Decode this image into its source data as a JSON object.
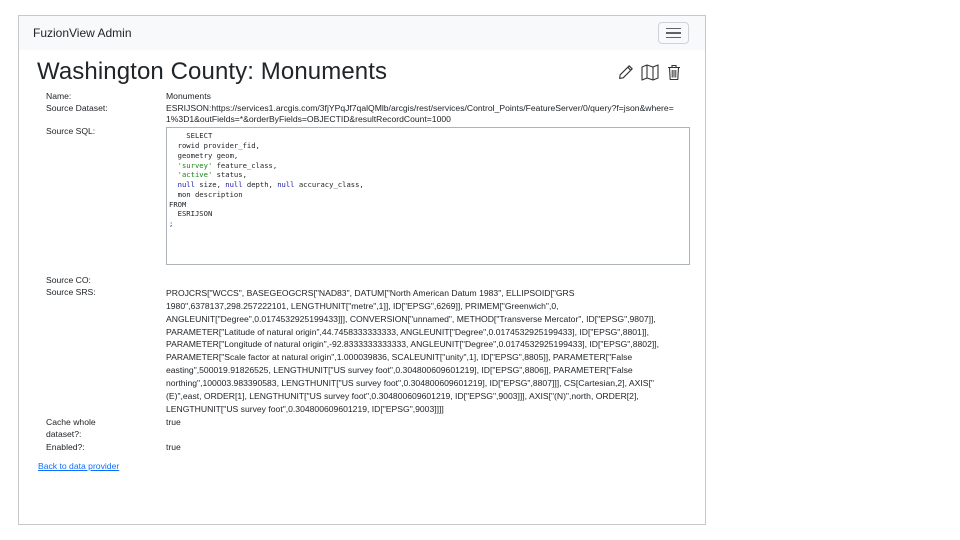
{
  "navbar": {
    "brand": "FuzionView Admin"
  },
  "page": {
    "title": "Washington County: Monuments"
  },
  "fields": {
    "name_label": "Name:",
    "name_value": "Monuments",
    "dataset_label": "Source Dataset:",
    "dataset_value": "ESRIJSON:https://services1.arcgis.com/3fjYPqJf7qalQMlb/arcgis/rest/services/Control_Points/FeatureServer/0/query?f=json&where=1%3D1&outFields=*&orderByFields=OBJECTID&resultRecordCount=1000",
    "sql_label": "Source SQL:",
    "sql": {
      "l1": "    SELECT",
      "l2": "  rowid provider_fid,",
      "l3": "  geometry geom,",
      "l4_str": "'survey'",
      "l4_rest": " feature_class,",
      "l5_str": "'active'",
      "l5_rest": " status,",
      "l6_kw1": "null",
      "l6_a": " size, ",
      "l6_kw2": "null",
      "l6_b": " depth, ",
      "l6_kw3": "null",
      "l6_c": " accuracy_class,",
      "l7": "  mon description",
      "l8": "FROM",
      "l9": "  ESRIJSON",
      "l10": ";"
    },
    "co_label": "Source CO:",
    "co_value": "",
    "srs_label": "Source SRS:",
    "srs_value": "PROJCRS[\"WCCS\", BASEGEOGCRS[\"NAD83\", DATUM[\"North American Datum 1983\", ELLIPSOID[\"GRS 1980\",6378137,298.257222101, LENGTHUNIT[\"metre\",1]], ID[\"EPSG\",6269]], PRIMEM[\"Greenwich\",0, ANGLEUNIT[\"Degree\",0.0174532925199433]]], CONVERSION[\"unnamed\", METHOD[\"Transverse Mercator\", ID[\"EPSG\",9807]], PARAMETER[\"Latitude of natural origin\",44.7458333333333, ANGLEUNIT[\"Degree\",0.0174532925199433], ID[\"EPSG\",8801]], PARAMETER[\"Longitude of natural origin\",-92.8333333333333, ANGLEUNIT[\"Degree\",0.0174532925199433], ID[\"EPSG\",8802]], PARAMETER[\"Scale factor at natural origin\",1.000039836, SCALEUNIT[\"unity\",1], ID[\"EPSG\",8805]], PARAMETER[\"False easting\",500019.91826525, LENGTHUNIT[\"US survey foot\",0.304800609601219], ID[\"EPSG\",8806]], PARAMETER[\"False northing\",100003.983390583, LENGTHUNIT[\"US survey foot\",0.304800609601219], ID[\"EPSG\",8807]]], CS[Cartesian,2], AXIS[\"(E)\",east, ORDER[1], LENGTHUNIT[\"US survey foot\",0.304800609601219, ID[\"EPSG\",9003]]], AXIS[\"(N)\",north, ORDER[2], LENGTHUNIT[\"US survey foot\",0.304800609601219, ID[\"EPSG\",9003]]]]",
    "cache_label": "Cache whole dataset?:",
    "cache_value": "true",
    "enabled_label": "Enabled?:",
    "enabled_value": "true"
  },
  "links": {
    "back": "Back to data provider"
  },
  "icons": {
    "edit": "pencil-icon",
    "map": "map-icon",
    "delete": "trash-icon"
  }
}
